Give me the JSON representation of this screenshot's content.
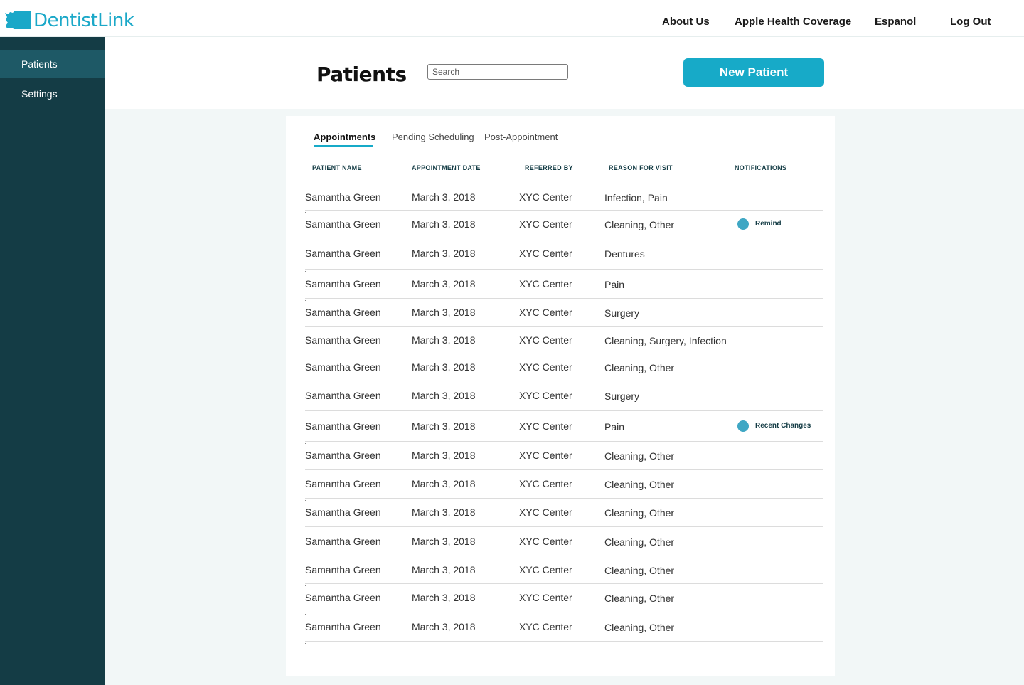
{
  "app": {
    "brand": "DentistLink",
    "colors": {
      "accent": "#17aac8",
      "sidebar": "#143c45",
      "sidebar_active": "#1e5966",
      "notification_dot": "#3fa7c4"
    }
  },
  "topnav": {
    "items": [
      "About Us",
      "Apple Health Coverage",
      "Espanol",
      "Log Out"
    ]
  },
  "sidebar": {
    "items": [
      {
        "label": "Patients",
        "active": true
      },
      {
        "label": "Settings",
        "active": false
      }
    ]
  },
  "header": {
    "title": "Patients",
    "search_placeholder": "Search",
    "new_patient_label": "New Patient"
  },
  "tabs": [
    {
      "label": "Appointments",
      "active": true
    },
    {
      "label": "Pending Scheduling",
      "active": false
    },
    {
      "label": "Post-Appointment",
      "active": false
    }
  ],
  "table": {
    "columns": [
      "PATIENT NAME",
      "APPOINTMENT DATE",
      "REFERRED BY",
      "REASON FOR VISIT",
      "NOTIFICATIONS"
    ],
    "rows": [
      {
        "name": "Samantha Green",
        "date": "March 3, 2018",
        "referred_by": "XYC Center",
        "reason": "Infection, Pain",
        "notification": ""
      },
      {
        "name": "Samantha Green",
        "date": "March 3, 2018",
        "referred_by": "XYC Center",
        "reason": "Cleaning, Other",
        "notification": "Remind"
      },
      {
        "name": "Samantha Green",
        "date": "March 3, 2018",
        "referred_by": "XYC Center",
        "reason": "Dentures",
        "notification": ""
      },
      {
        "name": "Samantha Green",
        "date": "March 3, 2018",
        "referred_by": "XYC Center",
        "reason": "Pain",
        "notification": ""
      },
      {
        "name": "Samantha Green",
        "date": "March 3, 2018",
        "referred_by": "XYC Center",
        "reason": "Surgery",
        "notification": ""
      },
      {
        "name": "Samantha Green",
        "date": "March 3, 2018",
        "referred_by": "XYC Center",
        "reason": "Cleaning, Surgery, Infection",
        "notification": ""
      },
      {
        "name": "Samantha Green",
        "date": "March 3, 2018",
        "referred_by": "XYC Center",
        "reason": "Cleaning, Other",
        "notification": ""
      },
      {
        "name": "Samantha Green",
        "date": "March 3, 2018",
        "referred_by": "XYC Center",
        "reason": "Surgery",
        "notification": ""
      },
      {
        "name": "Samantha Green",
        "date": "March 3, 2018",
        "referred_by": "XYC Center",
        "reason": "Pain",
        "notification": "Recent Changes"
      },
      {
        "name": "Samantha Green",
        "date": "March 3, 2018",
        "referred_by": "XYC Center",
        "reason": "Cleaning, Other",
        "notification": ""
      },
      {
        "name": "Samantha Green",
        "date": "March 3, 2018",
        "referred_by": "XYC Center",
        "reason": "Cleaning, Other",
        "notification": ""
      },
      {
        "name": "Samantha Green",
        "date": "March 3, 2018",
        "referred_by": "XYC Center",
        "reason": "Cleaning, Other",
        "notification": ""
      },
      {
        "name": "Samantha Green",
        "date": "March 3, 2018",
        "referred_by": "XYC Center",
        "reason": "Cleaning, Other",
        "notification": ""
      },
      {
        "name": "Samantha Green",
        "date": "March 3, 2018",
        "referred_by": "XYC Center",
        "reason": "Cleaning, Other",
        "notification": ""
      },
      {
        "name": "Samantha Green",
        "date": "March 3, 2018",
        "referred_by": "XYC Center",
        "reason": "Cleaning, Other",
        "notification": ""
      },
      {
        "name": "Samantha Green",
        "date": "March 3, 2018",
        "referred_by": "XYC Center",
        "reason": "Cleaning, Other",
        "notification": ""
      }
    ]
  }
}
